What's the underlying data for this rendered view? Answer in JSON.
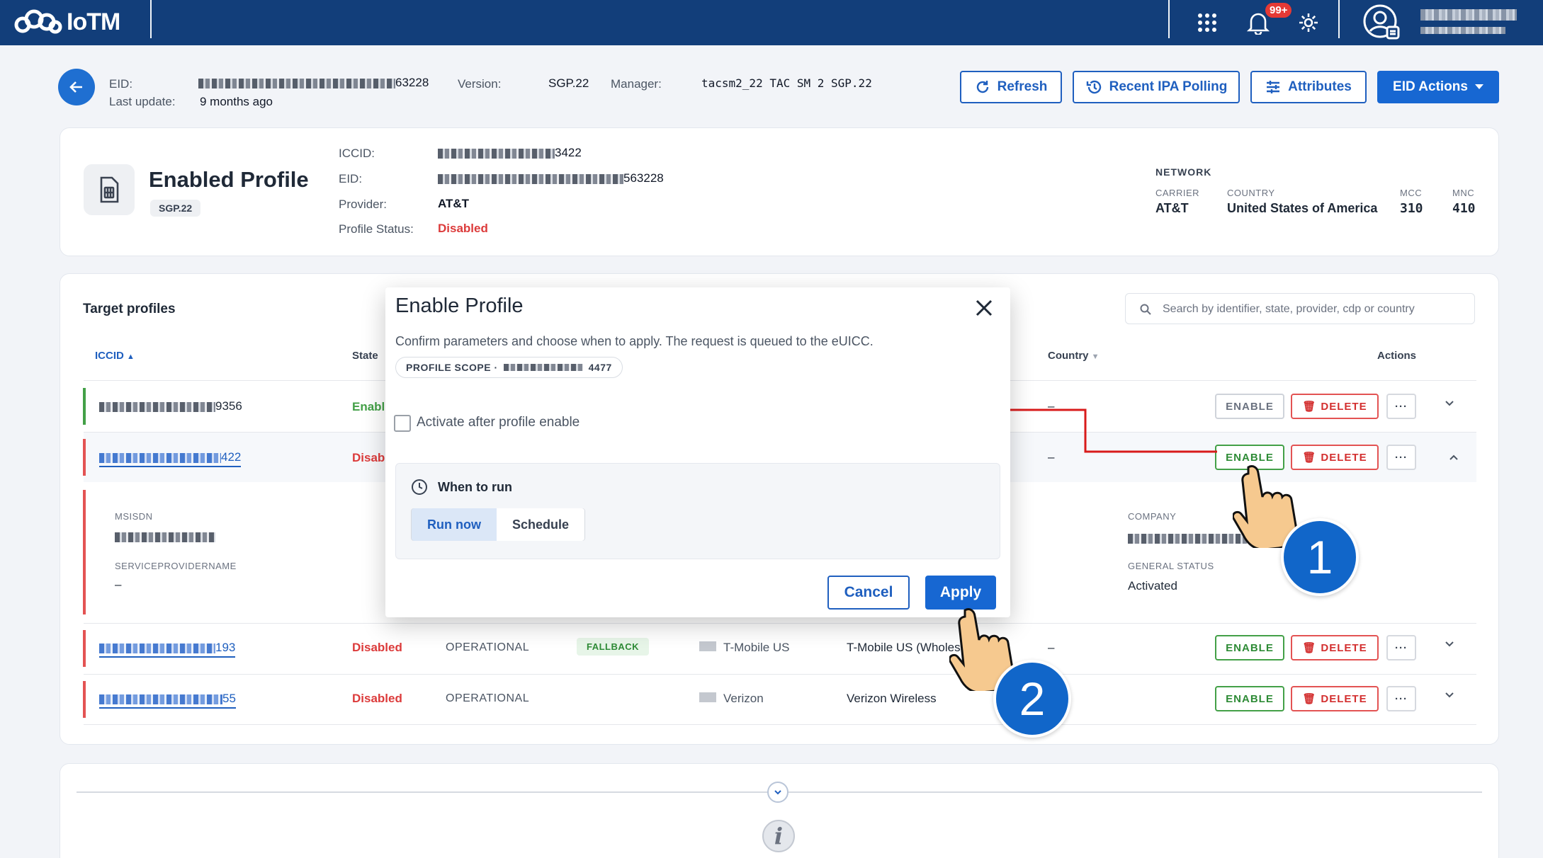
{
  "app": {
    "name": "IoTM",
    "notification_count": "99+"
  },
  "header": {
    "eid_label": "EID:",
    "eid_suffix": "63228",
    "last_update_label": "Last update:",
    "last_update_value": "9 months ago",
    "version_label": "Version:",
    "version_value": "SGP.22",
    "manager_label": "Manager:",
    "manager_value": "tacsm2_22 TAC SM 2 SGP.22",
    "buttons": {
      "refresh": "Refresh",
      "recent_ipa": "Recent IPA Polling",
      "attributes": "Attributes",
      "eid_actions": "EID Actions"
    }
  },
  "enabled_profile": {
    "title": "Enabled Profile",
    "chip": "SGP.22",
    "iccid_label": "ICCID:",
    "iccid_suffix": "3422",
    "eid_label": "EID:",
    "eid_suffix": "563228",
    "provider_label": "Provider:",
    "provider_value": "AT&T",
    "status_label": "Profile Status:",
    "status_value": "Disabled",
    "network": {
      "title": "NETWORK",
      "carrier_label": "CARRIER",
      "carrier_value": "AT&T",
      "country_label": "COUNTRY",
      "country_value": "United States of America",
      "mcc_label": "MCC",
      "mcc_value": "310",
      "mnc_label": "MNC",
      "mnc_value": "410"
    }
  },
  "target_profiles": {
    "title": "Target profiles",
    "search_placeholder": "Search by identifier, state, provider, cdp or country",
    "columns": {
      "iccid": "ICCID",
      "state": "State",
      "country": "Country",
      "actions": "Actions"
    },
    "rows": [
      {
        "iccid_suffix": "9356",
        "state": "Enabl",
        "country": "–",
        "enable": "ENABLE",
        "delete": "DELETE"
      },
      {
        "iccid_suffix": "422",
        "state": "Disab",
        "country": "–",
        "enable": "ENABLE",
        "delete": "DELETE"
      },
      {
        "iccid_suffix": "193",
        "state": "Disabled",
        "status": "OPERATIONAL",
        "tag": "FALLBACK",
        "provider": "T-Mobile US",
        "company": "T-Mobile US (Wholesal",
        "country": "–",
        "enable": "ENABLE",
        "delete": "DELETE"
      },
      {
        "iccid_suffix": "55",
        "state": "Disabled",
        "status": "OPERATIONAL",
        "provider": "Verizon",
        "company": "Verizon Wireless",
        "enable": "ENABLE",
        "delete": "DELETE"
      }
    ],
    "details": {
      "msisdn_label": "MSISDN",
      "spn_label": "SERVICEPROVIDERNAME",
      "spn_value": "–",
      "company_label": "COMPANY",
      "general_status_label": "GENERAL STATUS",
      "general_status_value": "Activated"
    }
  },
  "modal": {
    "title": "Enable Profile",
    "description": "Confirm parameters and choose when to apply. The request is queued to the eUICC.",
    "scope_label": "PROFILE SCOPE ·",
    "scope_suffix": "4477",
    "checkbox_label": "Activate after profile enable",
    "when_title": "When to run",
    "run_now": "Run now",
    "schedule": "Schedule",
    "cancel": "Cancel",
    "apply": "Apply"
  },
  "annotations": {
    "step1": "1",
    "step2": "2"
  },
  "colors": {
    "nav": "#123e7a",
    "primary": "#1767d2",
    "danger": "#dc3b3b",
    "success": "#43a047",
    "annotation": "#d81b1b"
  }
}
